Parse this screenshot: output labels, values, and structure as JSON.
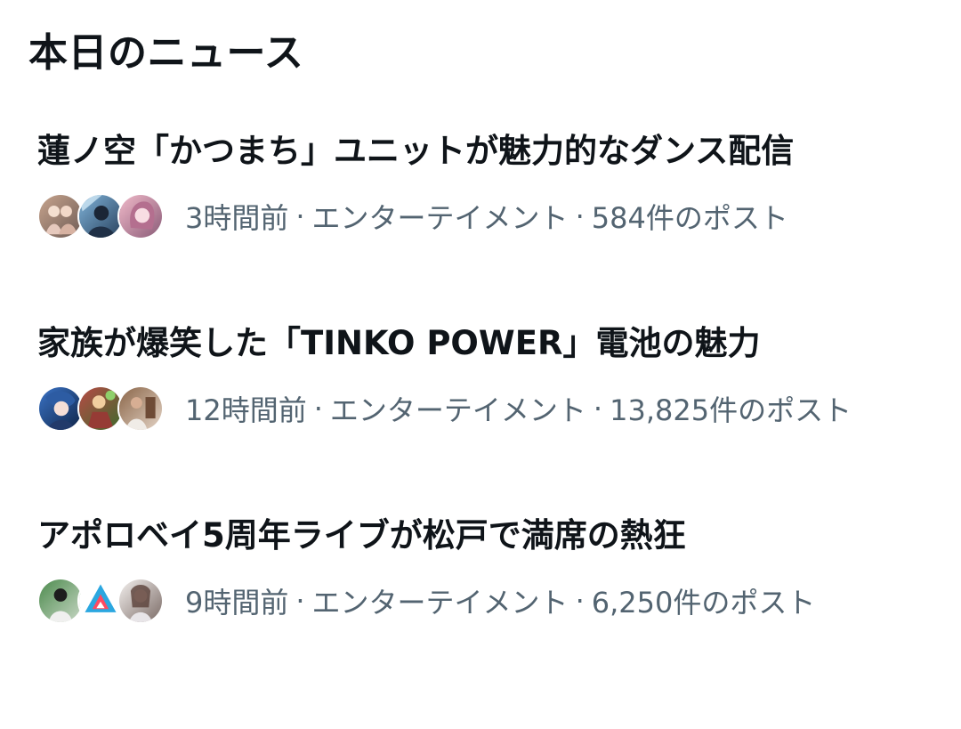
{
  "section": {
    "title": "本日のニュース"
  },
  "news": [
    {
      "headline": "蓮ノ空「かつまち」ユニットが魅力的なダンス配信",
      "time": "3時間前",
      "category": "エンターテイメント",
      "posts": "584件のポスト",
      "avatar_colors": [
        [
          "#c7a48d",
          "#6e5b55"
        ],
        [
          "#7fb2d8",
          "#28415d"
        ],
        [
          "#f0b9c9",
          "#8b5c78"
        ]
      ]
    },
    {
      "headline": "家族が爆笑した「TINKO POWER」電池の魅力",
      "time": "12時間前",
      "category": "エンターテイメント",
      "posts": "13,825件のポスト",
      "avatar_colors": [
        [
          "#3a73c6",
          "#0f2447"
        ],
        [
          "#b74a45",
          "#3d6b2d"
        ],
        [
          "#8b6649",
          "#e3d3c5"
        ]
      ]
    },
    {
      "headline": "アポロベイ5周年ライブが松戸で満席の熱狂",
      "time": "9時間前",
      "category": "エンターテイメント",
      "posts": "6,250件のポスト",
      "avatar_colors": [
        [
          "#4d8b4e",
          "#c8d7c5"
        ],
        [
          "#37a6d9",
          "#ff4c5d"
        ],
        [
          "#dcd5d1",
          "#7b6b66"
        ]
      ]
    }
  ],
  "separator": "·"
}
